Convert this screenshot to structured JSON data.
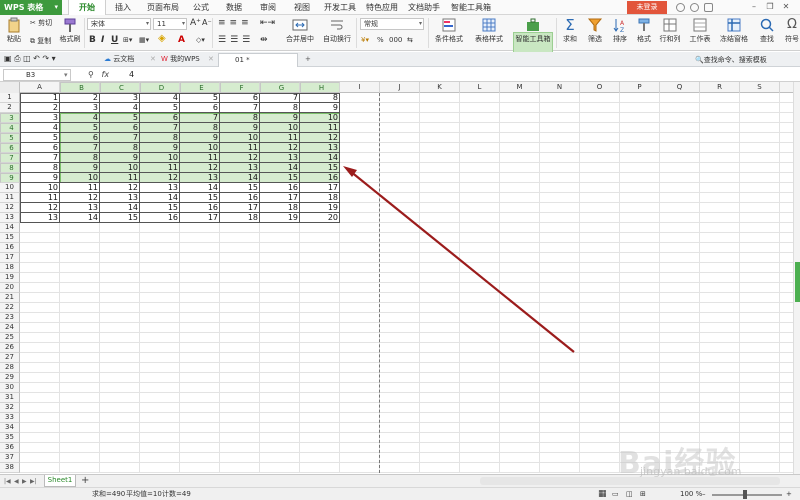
{
  "app": {
    "name": "WPS 表格"
  },
  "menu_tabs": [
    "开始",
    "插入",
    "页面布局",
    "公式",
    "数据",
    "审阅",
    "视图",
    "开发工具",
    "特色应用",
    "文档助手",
    "智能工具箱"
  ],
  "login_label": "未登录",
  "ribbon": {
    "paste": "粘贴",
    "cut": "剪切",
    "copy": "复制",
    "format_painter": "格式刷",
    "font_name": "宋体",
    "font_size": "11",
    "merge_center": "合并居中",
    "auto_wrap": "自动换行",
    "number_format": "常规",
    "conditional_format": "条件格式",
    "table_style": "表格样式",
    "smart_toolbox": "智能工具箱",
    "sum": "求和",
    "filter": "筛选",
    "sort": "排序",
    "format": "格式",
    "row_col": "行和列",
    "worksheet": "工作表",
    "freeze": "冻结窗格",
    "find": "查找",
    "symbol": "符号",
    "bold": "B",
    "italic": "I",
    "underline": "U",
    "font_color_a": "A",
    "percent": "%",
    "dec_format": "000"
  },
  "doc_tabs": {
    "cloud": "云文档",
    "my_wps": "我的WPS",
    "file": "01 *",
    "search_cmd": "查找命令、搜索模板"
  },
  "formula_bar": {
    "cell_ref": "B3",
    "fx": "fx",
    "value": "4"
  },
  "columns": [
    "A",
    "B",
    "C",
    "D",
    "E",
    "F",
    "G",
    "H",
    "I",
    "J",
    "K",
    "L",
    "M",
    "N",
    "O",
    "P",
    "Q",
    "R",
    "S"
  ],
  "row_count": 38,
  "data_rows": [
    [
      1,
      2,
      3,
      4,
      5,
      6,
      7,
      8
    ],
    [
      2,
      3,
      4,
      5,
      6,
      7,
      8,
      9
    ],
    [
      3,
      4,
      5,
      6,
      7,
      8,
      9,
      10
    ],
    [
      4,
      5,
      6,
      7,
      8,
      9,
      10,
      11
    ],
    [
      5,
      6,
      7,
      8,
      9,
      10,
      11,
      12
    ],
    [
      6,
      7,
      8,
      9,
      10,
      11,
      12,
      13
    ],
    [
      7,
      8,
      9,
      10,
      11,
      12,
      13,
      14
    ],
    [
      8,
      9,
      10,
      11,
      12,
      13,
      14,
      15
    ],
    [
      9,
      10,
      11,
      12,
      13,
      14,
      15,
      16
    ],
    [
      10,
      11,
      12,
      13,
      14,
      15,
      16,
      17
    ],
    [
      11,
      12,
      13,
      14,
      15,
      16,
      17,
      18
    ],
    [
      12,
      13,
      14,
      15,
      16,
      17,
      18,
      19
    ],
    [
      13,
      14,
      15,
      16,
      17,
      18,
      19,
      20
    ]
  ],
  "selection": {
    "first_row": 3,
    "last_row": 9,
    "first_col": "B",
    "last_col": "H"
  },
  "sheet_tab": "Sheet1",
  "status": {
    "sum": "求和=490",
    "average": "平均值=10",
    "count": "计数=49",
    "zoom": "100 %"
  },
  "annotation_color": "#9b1c1c",
  "accent_color": "#3d9a3d",
  "watermark": {
    "text": "Bai经验",
    "sub": "jingyan.baidu.com"
  }
}
